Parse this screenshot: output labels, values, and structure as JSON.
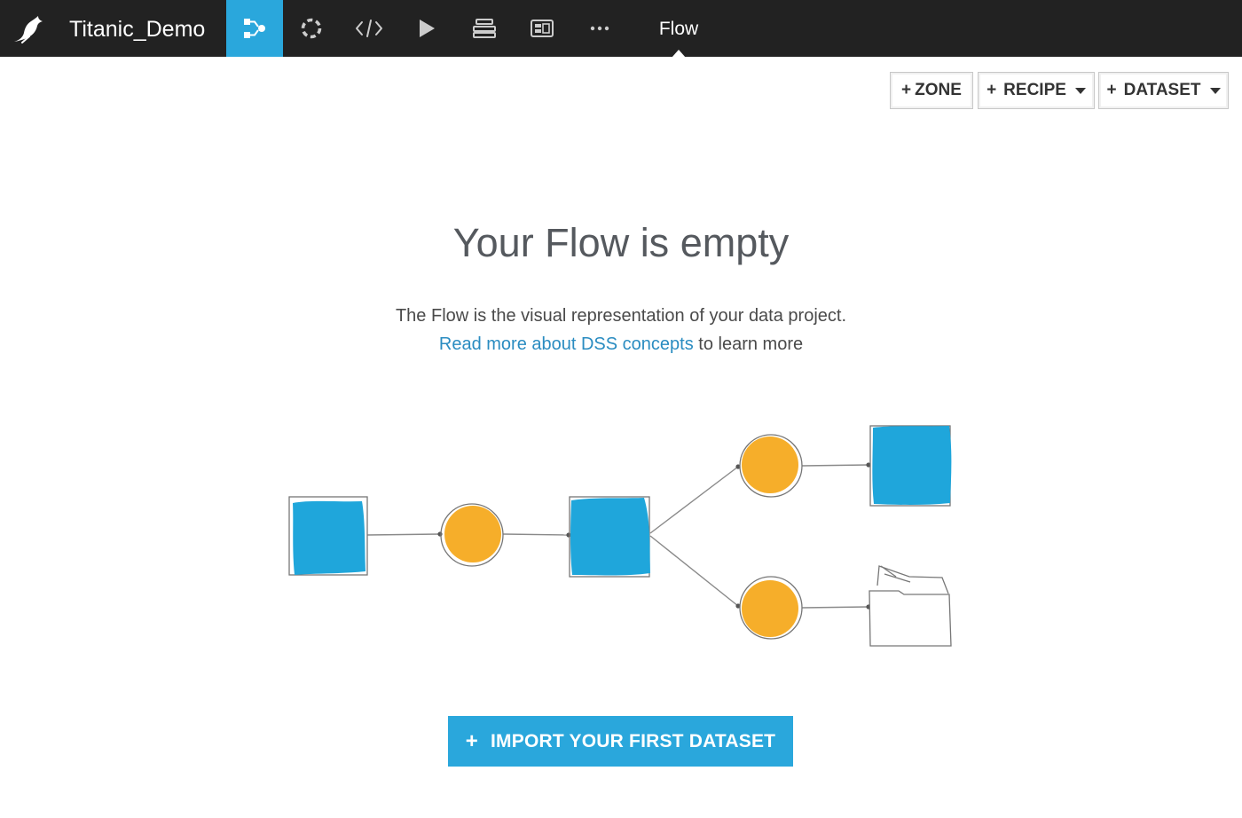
{
  "topbar": {
    "logo_icon": "dss-bird-logo-icon",
    "project_name": "Titanic_Demo",
    "nav_icons": [
      "flow-icon",
      "lab-icon",
      "code-icon",
      "jobs-icon",
      "datasets-icon",
      "dashboard-icon",
      "more-icon"
    ],
    "active_nav": "flow-icon",
    "context_title": "Flow",
    "colors": {
      "bar": "#222222",
      "active": "#2aa7dc"
    }
  },
  "toolbar": {
    "zone_label": "ZONE",
    "recipe_label": "RECIPE",
    "dataset_label": "DATASET"
  },
  "empty_state": {
    "title": "Your Flow is empty",
    "description": "The Flow is the visual representation of your data project.",
    "link_text": "Read more about DSS concepts",
    "link_suffix": " to learn more",
    "illustration_icons": [
      "dataset-square-icon",
      "recipe-circle-icon",
      "folder-icon"
    ],
    "colors": {
      "dataset": "#1fa6db",
      "recipe": "#f6ae2a",
      "link": "#2a8cc1"
    }
  },
  "import_button": {
    "label": "IMPORT YOUR FIRST DATASET",
    "color": "#2aa7dc"
  }
}
